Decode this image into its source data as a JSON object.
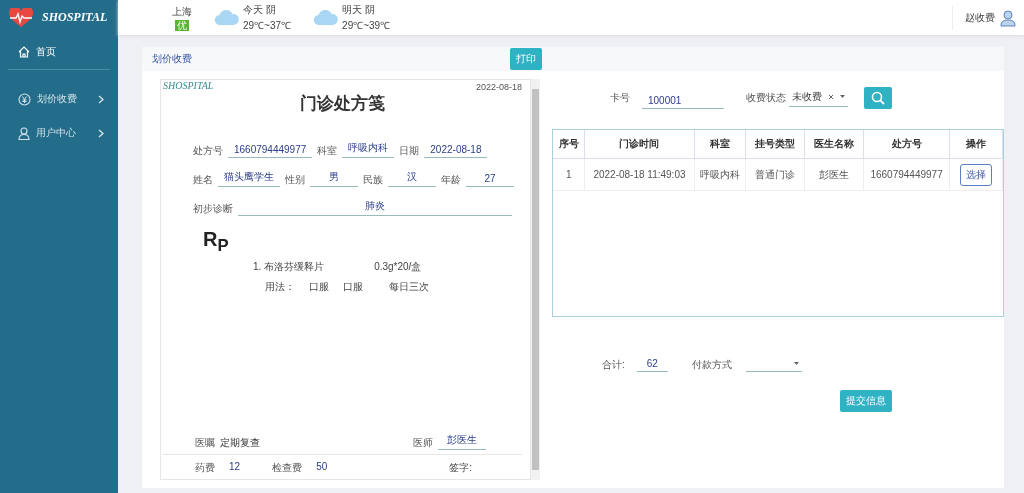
{
  "sidebar": {
    "logo": "SHOSPITAL",
    "items": [
      {
        "label": "首页",
        "expandable": false,
        "selected": true
      },
      {
        "label": "划价收费",
        "expandable": true,
        "selected": false
      },
      {
        "label": "用户中心",
        "expandable": true,
        "selected": false
      }
    ]
  },
  "header": {
    "city": "上海",
    "air_quality": "优",
    "days": [
      {
        "day": "今天",
        "condition": "阴",
        "temps": "29℃~37℃"
      },
      {
        "day": "明天",
        "condition": "阴",
        "temps": "29℃~39℃"
      }
    ],
    "user": "赵收费"
  },
  "card": {
    "title": "划价收费",
    "print_button": "打印"
  },
  "prescription": {
    "logo": "SHOSPITAL",
    "date": "2022-08-18",
    "title": "门诊处方笺",
    "rows": [
      [
        {
          "label": "处方号",
          "value": "1660794449977"
        },
        {
          "label": "科室",
          "value": "呼吸内科"
        },
        {
          "label": "日期",
          "value": "2022-08-18"
        }
      ],
      [
        {
          "label": "姓名",
          "value": "猫头鹰学生"
        },
        {
          "label": "性别",
          "value": "男"
        },
        {
          "label": "民族",
          "value": "汉"
        },
        {
          "label": "年龄",
          "value": "27"
        }
      ],
      [
        {
          "label": "初步诊断",
          "value": "肺炎"
        }
      ]
    ],
    "rp": "R$_{P}$",
    "medicines": [
      {
        "name": "1. 布洛芬缓释片",
        "spec": "0.3g*20/盒",
        "usage_label": "用法：",
        "usage": [
          "口服",
          "口服",
          "每日三次"
        ]
      }
    ],
    "advice_label": "医嘱",
    "advice": "定期复查",
    "doctor_label": "医师",
    "doctor": "彭医生",
    "fees": [
      {
        "label": "药费",
        "value": "12"
      },
      {
        "label": "检查费",
        "value": "50"
      }
    ],
    "signature_label": "签字:"
  },
  "search": {
    "card_label": "卡号",
    "card_value": "100001",
    "status_label": "收费状态",
    "status_value": "未收费"
  },
  "table": {
    "columns": [
      "序号",
      "门诊时间",
      "科室",
      "挂号类型",
      "医生名称",
      "处方号",
      "操作"
    ],
    "rows": [
      {
        "cells": [
          "1",
          "2022-08-18 11:49:03",
          "呼吸内科",
          "普通门诊",
          "彭医生",
          "1660794449977"
        ],
        "action": "选择"
      }
    ]
  },
  "summary": {
    "total_label": "合计:",
    "total": "62",
    "payment_label": "付款方式",
    "submit": "提交信息"
  }
}
